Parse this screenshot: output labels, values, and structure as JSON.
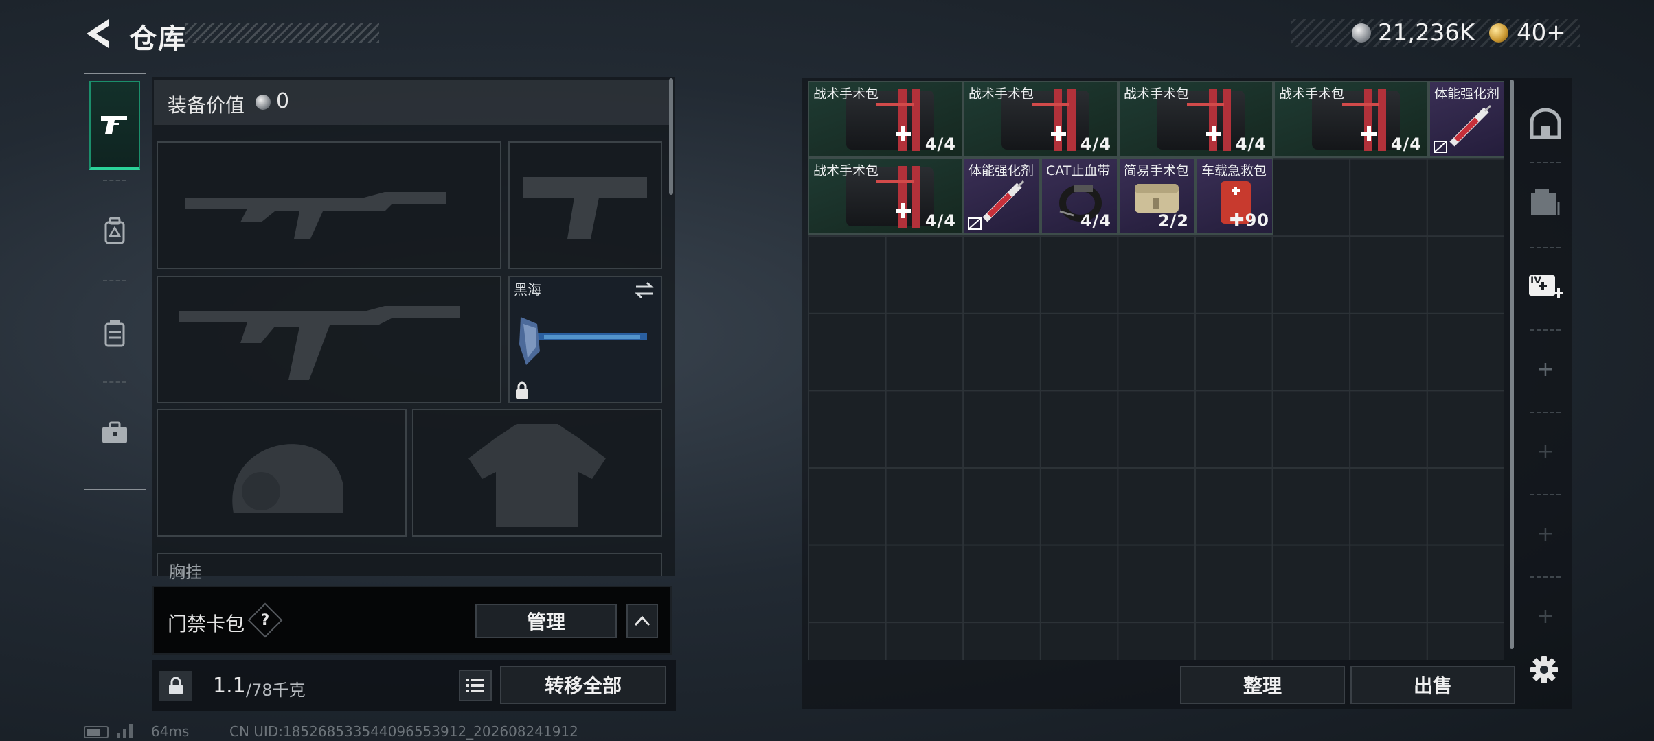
{
  "header": {
    "title": "仓库",
    "currency_silver": "21,236K",
    "currency_gold": "40+"
  },
  "equipment": {
    "value_label": "装备价值",
    "value": "0",
    "melee_name": "黑海",
    "chest_label": "胸挂"
  },
  "keycard": {
    "label": "门禁卡包",
    "help": "?",
    "manage_label": "管理"
  },
  "weight": {
    "current": "1.1",
    "max": "/78千克",
    "transfer_all_label": "转移全部"
  },
  "footer": {
    "ping": "64ms",
    "uid": "CN UID:185268533544096553912_202608241912"
  },
  "storage": {
    "items": [
      {
        "name": "战术手术包",
        "count": "4/4",
        "rarity": "green"
      },
      {
        "name": "战术手术包",
        "count": "4/4",
        "rarity": "green"
      },
      {
        "name": "战术手术包",
        "count": "4/4",
        "rarity": "green"
      },
      {
        "name": "战术手术包",
        "count": "4/4",
        "rarity": "green"
      },
      {
        "name": "体能强化剂",
        "count": "",
        "rarity": "purple"
      },
      {
        "name": "战术手术包",
        "count": "4/4",
        "rarity": "green"
      },
      {
        "name": "体能强化剂",
        "count": "",
        "rarity": "purple"
      },
      {
        "name": "CAT止血带",
        "count": "4/4",
        "rarity": "purple"
      },
      {
        "name": "简易手术包",
        "count": "2/2",
        "rarity": "purple"
      },
      {
        "name": "车载急救包",
        "count": "90",
        "rarity": "purple"
      }
    ],
    "sort_label": "整理",
    "sell_label": "出售"
  },
  "colors": {
    "accent_green": "#2bd39a",
    "rarity_green": "#1f3b33",
    "rarity_purple": "#3a2f55"
  }
}
